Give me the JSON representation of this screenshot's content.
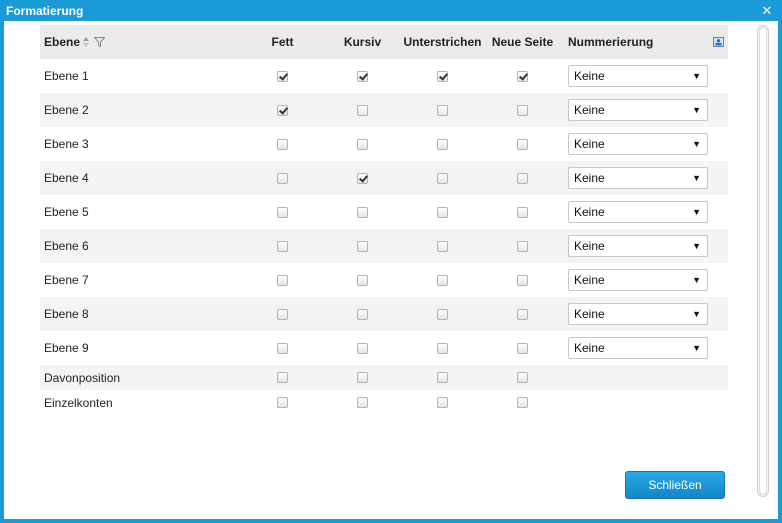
{
  "window": {
    "title": "Formatierung",
    "close_glyph": "✕"
  },
  "table": {
    "headers": {
      "name": "Ebene",
      "fett": "Fett",
      "kursiv": "Kursiv",
      "unterstrichen": "Unterstrichen",
      "neue_seite": "Neue Seite",
      "nummerierung": "Nummerierung"
    },
    "rows": [
      {
        "name": "Ebene 1",
        "fett": true,
        "kursiv": true,
        "unterstrichen": true,
        "neue_seite": true,
        "nummerierung": "Keine"
      },
      {
        "name": "Ebene 2",
        "fett": true,
        "kursiv": false,
        "unterstrichen": false,
        "neue_seite": false,
        "nummerierung": "Keine"
      },
      {
        "name": "Ebene 3",
        "fett": false,
        "kursiv": false,
        "unterstrichen": false,
        "neue_seite": false,
        "nummerierung": "Keine"
      },
      {
        "name": "Ebene 4",
        "fett": false,
        "kursiv": true,
        "unterstrichen": false,
        "neue_seite": false,
        "nummerierung": "Keine"
      },
      {
        "name": "Ebene 5",
        "fett": false,
        "kursiv": false,
        "unterstrichen": false,
        "neue_seite": false,
        "nummerierung": "Keine"
      },
      {
        "name": "Ebene 6",
        "fett": false,
        "kursiv": false,
        "unterstrichen": false,
        "neue_seite": false,
        "nummerierung": "Keine"
      },
      {
        "name": "Ebene 7",
        "fett": false,
        "kursiv": false,
        "unterstrichen": false,
        "neue_seite": false,
        "nummerierung": "Keine"
      },
      {
        "name": "Ebene 8",
        "fett": false,
        "kursiv": false,
        "unterstrichen": false,
        "neue_seite": false,
        "nummerierung": "Keine"
      },
      {
        "name": "Ebene 9",
        "fett": false,
        "kursiv": false,
        "unterstrichen": false,
        "neue_seite": false,
        "nummerierung": "Keine"
      },
      {
        "name": "Davonposition",
        "fett": false,
        "kursiv": false,
        "unterstrichen": false,
        "neue_seite": false,
        "nummerierung": null
      },
      {
        "name": "Einzelkonten",
        "fett": false,
        "kursiv": false,
        "unterstrichen": false,
        "neue_seite": false,
        "nummerierung": null
      }
    ]
  },
  "icons": {
    "sort": "sort-icon",
    "filter": "filter-icon",
    "column_config": "column-config-icon",
    "close": "close-icon"
  },
  "footer": {
    "close_button_label": "Schließen"
  },
  "colors": {
    "titlebar": "#1a9ad6",
    "button": "#1a97d9"
  }
}
